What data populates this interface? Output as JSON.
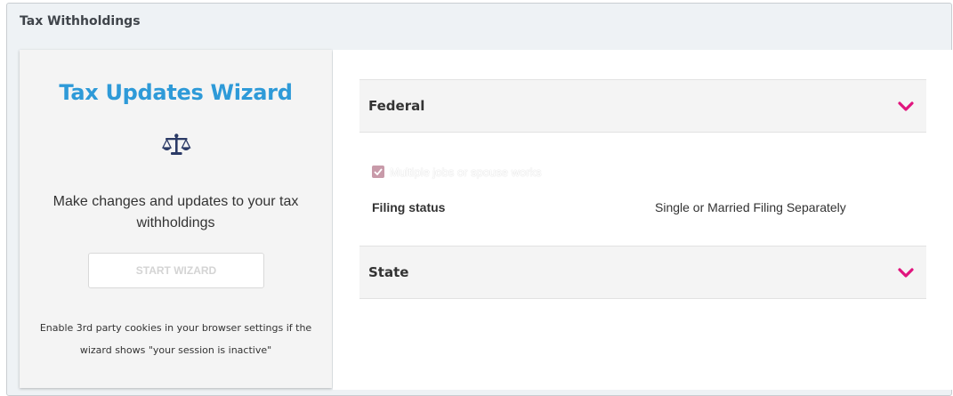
{
  "panel": {
    "title": "Tax Withholdings"
  },
  "wizard": {
    "title": "Tax Updates Wizard",
    "icon": "scale-icon",
    "description": "Make changes and updates to your tax withholdings",
    "button_label": "START WIZARD",
    "cookie_note": "Enable 3rd party cookies in your browser settings if the wizard shows \"your session is inactive\""
  },
  "federal": {
    "label": "Federal",
    "expanded": true,
    "checkbox_label": "Multiple jobs or spouse works",
    "checkbox_checked": true,
    "filing_status_label": "Filing status",
    "filing_status_value": "Single or Married Filing Separately"
  },
  "state": {
    "label": "State",
    "expanded": false
  },
  "colors": {
    "wizard_title": "#2e9ad8",
    "chevron": "#e0157e",
    "icon": "#2b3a66"
  }
}
